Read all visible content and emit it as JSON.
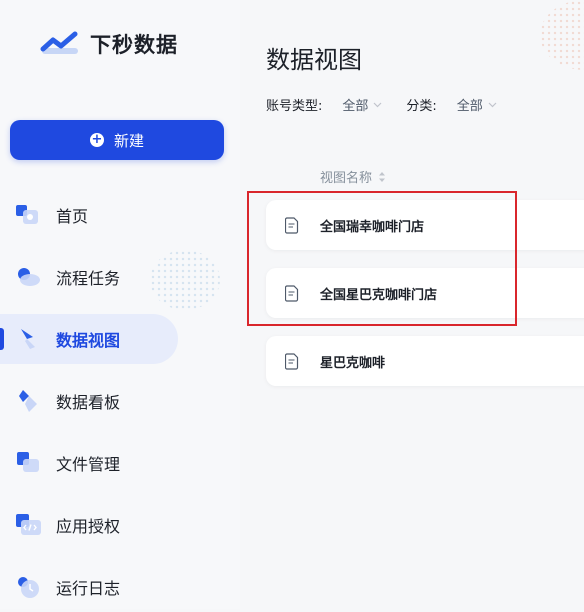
{
  "app": {
    "name": "下秒数据",
    "logo_icon": "chart-line-logo-icon"
  },
  "sidebar": {
    "new_button": {
      "label": "新建",
      "icon": "plus-circle-icon"
    },
    "items": [
      {
        "label": "首页",
        "icon": "home-icon",
        "active": false
      },
      {
        "label": "流程任务",
        "icon": "cloud-icon",
        "active": false
      },
      {
        "label": "数据视图",
        "icon": "cursor-icon",
        "active": true
      },
      {
        "label": "数据看板",
        "icon": "diamond-icon",
        "active": false
      },
      {
        "label": "文件管理",
        "icon": "folder-icon",
        "active": false
      },
      {
        "label": "应用授权",
        "icon": "code-icon",
        "active": false
      },
      {
        "label": "运行日志",
        "icon": "log-icon",
        "active": false
      }
    ]
  },
  "main": {
    "title": "数据视图",
    "filters": {
      "account_type_label": "账号类型:",
      "account_type_value": "全部",
      "category_label": "分类:",
      "category_value": "全部"
    },
    "table": {
      "column_header": "视图名称",
      "rows": [
        {
          "name": "全国瑞幸咖啡门店"
        },
        {
          "name": "全国星巴克咖啡门店"
        },
        {
          "name": "星巴克咖啡"
        }
      ]
    }
  },
  "colors": {
    "accent": "#1f49e0",
    "highlight_border": "#d9262c"
  }
}
